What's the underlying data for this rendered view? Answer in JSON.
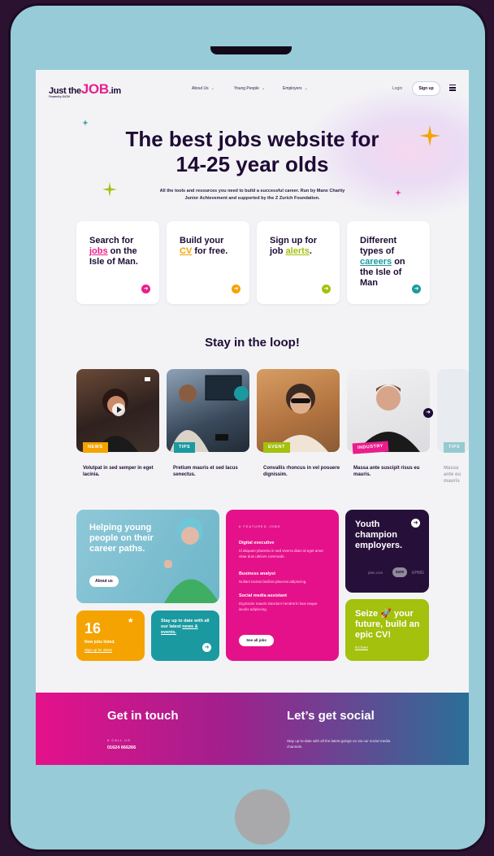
{
  "nav": {
    "logo_prefix": "Just the",
    "logo_main": "JOB",
    "logo_suffix": ".im",
    "logo_powered": "Powered by JA IOM",
    "links": [
      "About Us",
      "Young People",
      "Employers"
    ],
    "login": "Login",
    "signup": "Sign up"
  },
  "hero": {
    "title_line1": "The best jobs website for",
    "title_line2": "14-25 year olds",
    "subtitle_line1": "All the tools and resources you need to build a successful career. Run by Manx Charity",
    "subtitle_line2": "Junior Achievement and supported by the Z Zurich Foundation."
  },
  "cards": [
    {
      "pre": "Search for",
      "link": "jobs",
      "post": " on the Isle of Man.",
      "accent": "#e91e8c"
    },
    {
      "pre": "Build your",
      "link": "CV",
      "post": " for free.",
      "accent": "#f4a300"
    },
    {
      "pre": "Sign up for job ",
      "link": "alerts",
      "post": ".",
      "accent": "#a3c10d"
    },
    {
      "pre": "Different types of ",
      "link": "careers",
      "post": " on the Isle of Man",
      "accent": "#1a9aa0"
    }
  ],
  "loop": {
    "title": "Stay in the loop!",
    "items": [
      {
        "tag": "NEWS",
        "caption": "Volutpat in sed semper in eget lacinia.",
        "color": "#f4a300"
      },
      {
        "tag": "TIPS",
        "caption": "Pretium mauris et sed lacus senectus.",
        "color": "#1a9aa0"
      },
      {
        "tag": "EVENT",
        "caption": "Convallis rhoncus in vel posuere dignissim.",
        "color": "#a3c10d"
      },
      {
        "tag": "INDUSTRY",
        "caption": "Massa ante suscipit risus eu mauris.",
        "color": "#e91e8c"
      },
      {
        "tag": "TIPS",
        "caption": "Massa ante eu mauris",
        "color": "#1a9aa0"
      }
    ]
  },
  "helping": {
    "title": "Helping young people on their career paths.",
    "button": "About us"
  },
  "jobs_count": {
    "number": "16",
    "label": "New jobs listed.",
    "link": "Sign up for alerts",
    "star": "*"
  },
  "stay": {
    "text": "Stay up to date with all our latest",
    "link": "news & events."
  },
  "featured": {
    "kicker": "# FEATURED JOBS",
    "jobs": [
      {
        "title": "Digital executive",
        "desc": "Id aliquam pharetra in sed viverra diam id eget amet vitae duis ultrices commodo."
      },
      {
        "title": "Business analyst",
        "desc": "Nullam lacinia facilisis placerat adipiscing."
      },
      {
        "title": "Social media assistant",
        "desc": "Dignissim mauris interdum hendrerit risus neque iaculis adipiscing."
      }
    ],
    "button": "See all jobs"
  },
  "youth": {
    "title": "Youth champion employers.",
    "logos": [
      "plan.com",
      "sure",
      "KPMG"
    ]
  },
  "cv": {
    "title": "Seize 🚀 your future, build an epic CV!",
    "link": "It's free!"
  },
  "footer": {
    "contact_title": "Get in touch",
    "call_label": "# CALL US",
    "phone": "01624 666266",
    "social_title": "Let’s get social",
    "social_text": "Stay up-to-date with all the latest goings on via our social media channels."
  }
}
